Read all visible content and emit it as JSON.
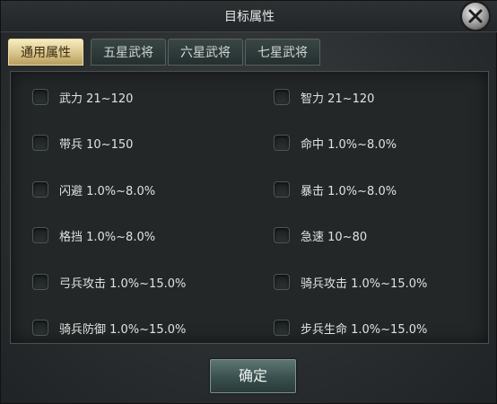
{
  "dialog": {
    "title": "目标属性",
    "close_icon": "close-icon"
  },
  "tabs": [
    {
      "label": "通用属性",
      "active": true
    },
    {
      "label": "五星武将",
      "active": false
    },
    {
      "label": "六星武将",
      "active": false
    },
    {
      "label": "七星武将",
      "active": false
    }
  ],
  "options": [
    {
      "label": "武力 21~120",
      "checked": false
    },
    {
      "label": "智力 21~120",
      "checked": false
    },
    {
      "label": "带兵 10~150",
      "checked": false
    },
    {
      "label": "命中 1.0%~8.0%",
      "checked": false
    },
    {
      "label": "闪避 1.0%~8.0%",
      "checked": false
    },
    {
      "label": "暴击 1.0%~8.0%",
      "checked": false
    },
    {
      "label": "格挡 1.0%~8.0%",
      "checked": false
    },
    {
      "label": "急速 10~80",
      "checked": false
    },
    {
      "label": "弓兵攻击 1.0%~15.0%",
      "checked": false
    },
    {
      "label": "骑兵攻击 1.0%~15.0%",
      "checked": false
    },
    {
      "label": "骑兵防御 1.0%~15.0%",
      "checked": false
    },
    {
      "label": "步兵生命 1.0%~15.0%",
      "checked": false
    }
  ],
  "confirm_label": "确定",
  "colors": {
    "active_tab": "#d9c48a",
    "panel_bg": "#232727",
    "button": "#3a504e"
  }
}
